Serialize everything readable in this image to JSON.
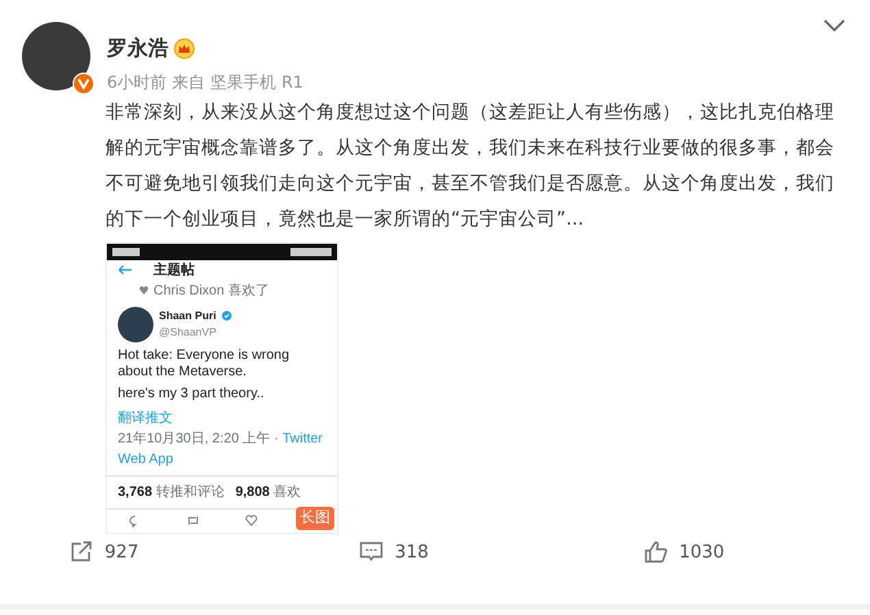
{
  "author": {
    "name": "罗永浩",
    "verified": true,
    "member_badge": true
  },
  "meta": {
    "time": "6小时前",
    "source_prefix": "来自",
    "source": "坚果手机 R1"
  },
  "text": "非常深刻，从来没从这个角度想过这个问题（这差距让人有些伤感），这比扎克伯格理解的元宇宙概念靠谱多了。从这个角度出发，我们未来在科技行业要做的很多事，都会不可避免地引领我们走向这个元宇宙，甚至不管我们是否愿意。从这个角度出发，我们的下一个创业项目，竟然也是一家所谓的“元宇宙公司”...",
  "image": {
    "header_title": "主题帖",
    "liked_by": "Chris Dixon 喜欢了",
    "tweet_author": "Shaan Puri",
    "verified": true,
    "handle": "@ShaanVP",
    "tweet_lines": [
      "Hot take: Everyone is wrong about the Metaverse.",
      "here's my 3 part theory.."
    ],
    "translate": "翻译推文",
    "date": "21年10月30日, 2:20 上午 · ",
    "client": "Twitter Web App",
    "stats": [
      {
        "count": "3,768",
        "label": "转推和评论"
      },
      {
        "count": "9,808",
        "label": "喜欢"
      }
    ],
    "badge": "长图"
  },
  "actions": [
    {
      "kind": "repost",
      "count": "927"
    },
    {
      "kind": "comment",
      "count": "318"
    },
    {
      "kind": "like",
      "count": "1030"
    }
  ]
}
